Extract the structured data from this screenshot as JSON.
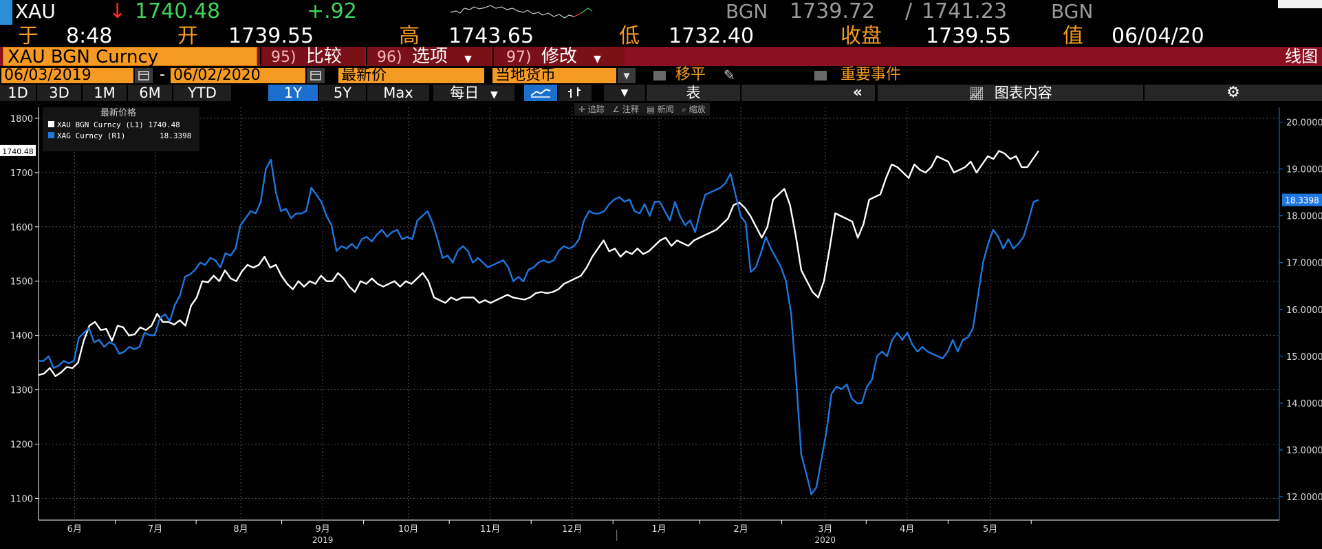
{
  "header": {
    "ticker": "XAU",
    "change_arrow": "↓",
    "last": "1740.48",
    "change": "+.92",
    "bid_source": "BGN",
    "bid": "1739.72",
    "slash": "/",
    "ask": "1741.23",
    "ask_source": "BGN",
    "time_label": "于",
    "time": "8:48",
    "open_label": "开",
    "open": "1739.55",
    "high_label": "高",
    "high": "1743.65",
    "low_label": "低",
    "low": "1732.40",
    "close_label": "收盘",
    "close": "1739.55",
    "value_label": "值",
    "value_date": "06/04/20"
  },
  "toolbar": {
    "security": "XAU BGN Curncy",
    "compare_num": "95)",
    "compare": "比较",
    "options_num": "96)",
    "options": "选项",
    "edit_num": "97)",
    "edit": "修改",
    "chart_type": "线图",
    "start_date": "06/03/2019",
    "dash": "-",
    "end_date": "06/02/2020",
    "price_type": "最新价",
    "currency": "当地货币",
    "moving_avg": "移平",
    "events": "重要事件",
    "table": "表",
    "chart_contents": "图表内容",
    "periods": [
      "1D",
      "3D",
      "1M",
      "6M",
      "YTD",
      "1Y",
      "5Y",
      "Max"
    ],
    "active_period": "1Y",
    "frequency": "每日",
    "chart_tools": [
      "追踪",
      "注释",
      "新闻",
      "缩放"
    ]
  },
  "legend": {
    "title": "最新价格",
    "items": [
      {
        "label": "XAU BGN Curncy  (L1) 1740.48",
        "color": "#ffffff"
      },
      {
        "label": "XAG Curncy  (R1)",
        "value": "18.3398",
        "color": "#1f77e0"
      }
    ]
  },
  "colors": {
    "accent": "#f59a23",
    "bar_red": "#8a1220",
    "active_tab": "#1d6fce",
    "gold_line": "#ffffff",
    "silver_line": "#1f77e0"
  },
  "chart_data": {
    "type": "line",
    "left_axis": {
      "ticks": [
        "1800",
        "1700",
        "1600",
        "1500",
        "1400",
        "1300",
        "1200",
        "1100"
      ],
      "ylim": [
        1060,
        1810
      ]
    },
    "right_axis": {
      "ticks": [
        "20.0000",
        "19.0000",
        "18.0000",
        "17.0000",
        "16.0000",
        "15.0000",
        "14.0000",
        "13.0000",
        "12.0000"
      ],
      "ylim": [
        11.5,
        20.2
      ]
    },
    "last_labels": {
      "left": "1740.48",
      "right": "18.3398"
    },
    "x_ticks": [
      "6月",
      "7月",
      "8月",
      "9月",
      "10月",
      "11月",
      "12月",
      "1月",
      "2月",
      "3月",
      "4月",
      "5月"
    ],
    "x_years": [
      "2019",
      "2020"
    ],
    "grid": true,
    "series": [
      {
        "name": "XAU BGN Curncy",
        "axis": "left",
        "values": [
          1327,
          1330,
          1340,
          1325,
          1332,
          1342,
          1340,
          1350,
          1390,
          1418,
          1425,
          1410,
          1412,
          1390,
          1418,
          1415,
          1400,
          1402,
          1415,
          1410,
          1418,
          1440,
          1425,
          1425,
          1420,
          1428,
          1418,
          1455,
          1470,
          1500,
          1498,
          1510,
          1500,
          1520,
          1505,
          1500,
          1518,
          1530,
          1525,
          1530,
          1545,
          1525,
          1530,
          1510,
          1495,
          1485,
          1500,
          1490,
          1500,
          1495,
          1510,
          1500,
          1500,
          1515,
          1505,
          1490,
          1480,
          1500,
          1495,
          1505,
          1495,
          1490,
          1495,
          1500,
          1490,
          1500,
          1495,
          1505,
          1515,
          1500,
          1470,
          1465,
          1460,
          1470,
          1465,
          1470,
          1470,
          1470,
          1460,
          1465,
          1460,
          1465,
          1470,
          1475,
          1470,
          1468,
          1466,
          1470,
          1478,
          1480,
          1478,
          1480,
          1485,
          1495,
          1500,
          1505,
          1510,
          1525,
          1545,
          1560,
          1575,
          1555,
          1560,
          1545,
          1555,
          1550,
          1560,
          1550,
          1555,
          1565,
          1575,
          1580,
          1565,
          1575,
          1570,
          1565,
          1575,
          1580,
          1585,
          1590,
          1595,
          1605,
          1615,
          1640,
          1645,
          1635,
          1620,
          1600,
          1580,
          1600,
          1650,
          1660,
          1670,
          1640,
          1585,
          1520,
          1500,
          1480,
          1470,
          1500,
          1560,
          1625,
          1620,
          1615,
          1610,
          1580,
          1605,
          1650,
          1655,
          1660,
          1690,
          1715,
          1710,
          1700,
          1690,
          1715,
          1705,
          1700,
          1710,
          1730,
          1725,
          1720,
          1700,
          1705,
          1710,
          1720,
          1700,
          1715,
          1730,
          1725,
          1740,
          1735,
          1725,
          1730,
          1710,
          1710,
          1725,
          1740
        ]
      },
      {
        "name": "XAG Curncy",
        "axis": "right",
        "values": [
          14.9,
          14.9,
          15.0,
          14.75,
          14.8,
          14.9,
          14.85,
          14.9,
          15.4,
          15.5,
          15.6,
          15.3,
          15.35,
          15.2,
          15.3,
          15.25,
          15.05,
          15.1,
          15.2,
          15.15,
          15.2,
          15.5,
          15.45,
          15.45,
          15.8,
          15.9,
          15.75,
          16.1,
          16.3,
          16.7,
          16.75,
          16.85,
          17.0,
          16.95,
          17.1,
          17.05,
          16.9,
          17.2,
          17.15,
          17.3,
          17.8,
          17.95,
          18.1,
          18.05,
          18.3,
          19.0,
          19.2,
          18.5,
          18.1,
          18.15,
          17.95,
          18.05,
          18.05,
          18.1,
          18.6,
          18.45,
          18.3,
          18.0,
          17.8,
          17.25,
          17.35,
          17.3,
          17.4,
          17.3,
          17.5,
          17.55,
          17.45,
          17.6,
          17.7,
          17.55,
          17.65,
          17.7,
          17.5,
          17.55,
          17.5,
          17.9,
          18.0,
          18.1,
          17.85,
          17.5,
          17.1,
          17.15,
          17.0,
          17.25,
          17.35,
          17.25,
          17.0,
          17.1,
          17.0,
          16.9,
          16.95,
          17.0,
          17.05,
          16.9,
          16.6,
          16.7,
          16.6,
          16.85,
          16.9,
          17.0,
          17.05,
          17.0,
          17.05,
          17.25,
          17.35,
          17.3,
          17.35,
          17.5,
          17.9,
          18.1,
          18.05,
          18.05,
          18.1,
          18.25,
          18.35,
          18.4,
          18.3,
          18.35,
          18.1,
          18.05,
          18.25,
          18.0,
          18.3,
          18.3,
          18.1,
          17.9,
          18.3,
          18.0,
          17.8,
          17.9,
          17.65,
          18.1,
          18.45,
          18.5,
          18.55,
          18.6,
          18.7,
          18.9,
          18.45,
          18.0,
          17.85,
          16.8,
          16.9,
          17.2,
          17.55,
          17.3,
          17.1,
          16.9,
          16.6,
          15.9,
          14.5,
          12.9,
          12.5,
          12.05,
          12.2,
          12.8,
          13.4,
          14.2,
          14.35,
          14.3,
          14.4,
          14.1,
          14.0,
          14.0,
          14.35,
          14.5,
          15.0,
          15.1,
          15.0,
          15.35,
          15.5,
          15.35,
          15.5,
          15.25,
          15.1,
          15.2,
          15.1,
          15.05,
          15.0,
          14.95,
          15.1,
          15.35,
          15.1,
          15.35,
          15.4,
          15.6,
          16.3,
          17.0,
          17.4,
          17.7,
          17.55,
          17.3,
          17.5,
          17.3,
          17.4,
          17.55,
          17.9,
          18.3,
          18.34
        ]
      }
    ]
  }
}
